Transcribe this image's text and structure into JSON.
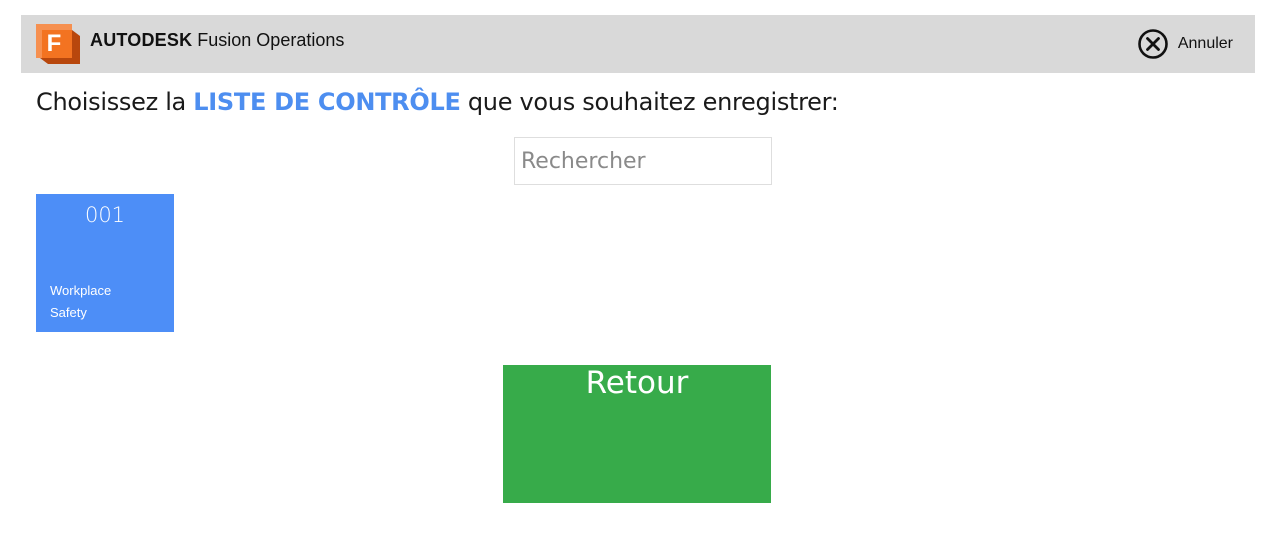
{
  "header": {
    "brand_bold": "AUTODESK",
    "brand_product": "Fusion Operations",
    "logo_letter": "F",
    "cancel_label": "Annuler"
  },
  "prompt": {
    "prefix": "Choisissez la ",
    "highlight": "LISTE DE CONTRÔLE",
    "suffix": " que vous souhaitez enregistrer:"
  },
  "search": {
    "placeholder": "Rechercher",
    "value": ""
  },
  "checklists": [
    {
      "code": "001",
      "line1": "Workplace",
      "line2": "Safety"
    }
  ],
  "actions": {
    "back_label": "Retour"
  },
  "colors": {
    "header_bg": "#d9d9d9",
    "accent_blue": "#4d8ef0",
    "tile_blue": "#4d8ef7",
    "back_green": "#37ab4a",
    "logo_orange": "#f37321"
  },
  "icons": {
    "logo": "autodesk-fusion-logo",
    "cancel": "close-circle-icon"
  }
}
